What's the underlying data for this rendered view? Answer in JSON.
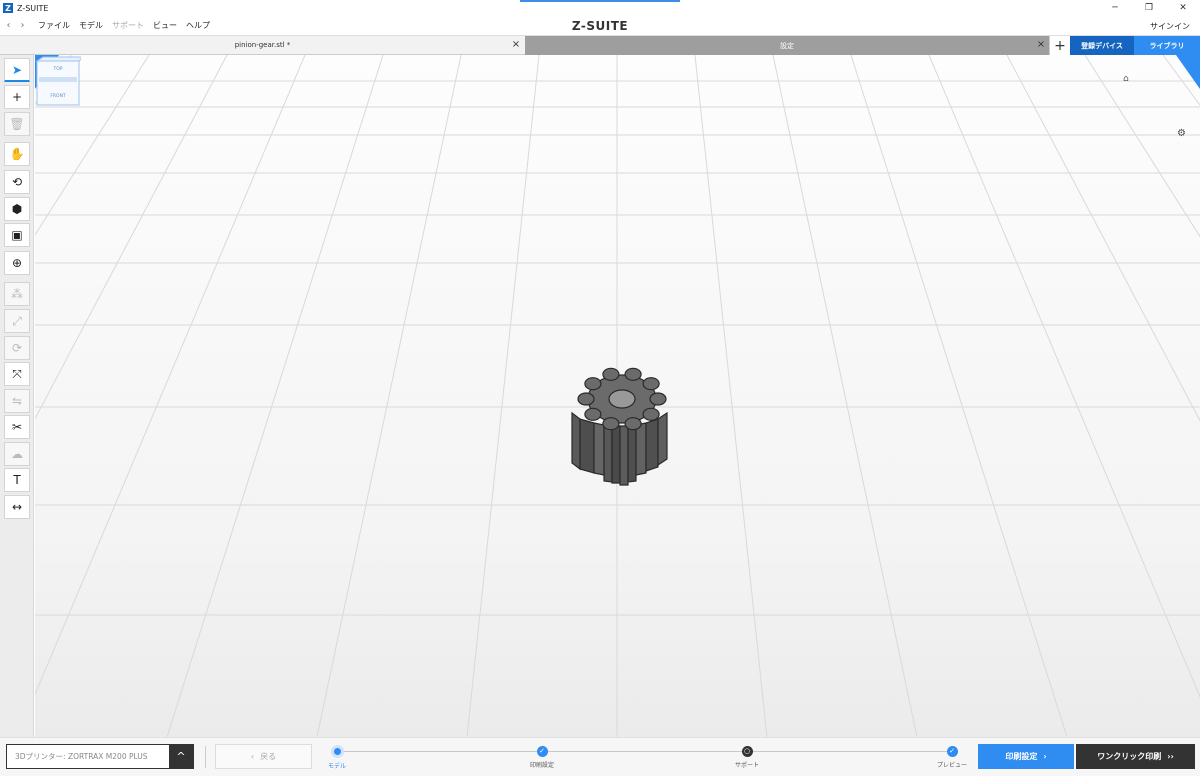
{
  "window": {
    "logo": "Z",
    "title": "Z-SUITE",
    "minimize": "─",
    "restore": "❐",
    "close": "✕"
  },
  "menu": {
    "back": "‹",
    "forward": "›",
    "items": [
      {
        "label": "ファイル",
        "enabled": true
      },
      {
        "label": "モデル",
        "enabled": true
      },
      {
        "label": "サポート",
        "enabled": false
      },
      {
        "label": "ビュー",
        "enabled": true
      },
      {
        "label": "ヘルプ",
        "enabled": true
      }
    ],
    "brand": "Z-SUITE",
    "signin": "サインイン"
  },
  "tabs": {
    "file_tab": "pinion-gear.stl *",
    "settings_tab": "設定",
    "close_glyph": "×",
    "add_glyph": "+",
    "devices": "登録デバイス",
    "library": "ライブラリ"
  },
  "toolbar": {
    "tools": [
      {
        "name": "select-tool",
        "icon": "cursor-icon",
        "glyph": "➤",
        "state": "active"
      },
      {
        "name": "add-model-tool",
        "icon": "plus-icon",
        "glyph": "+",
        "state": "enabled"
      },
      {
        "name": "delete-tool",
        "icon": "trash-icon",
        "glyph": "🗑",
        "state": "disabled"
      },
      {
        "name": "pan-tool",
        "icon": "hand-icon",
        "glyph": "✋",
        "state": "enabled"
      },
      {
        "name": "rotate-view-tool",
        "icon": "rotate-icon",
        "glyph": "⟲",
        "state": "enabled"
      },
      {
        "name": "view-cube-tool",
        "icon": "cube-icon",
        "glyph": "⬢",
        "state": "enabled"
      },
      {
        "name": "camera-tool",
        "icon": "camera-icon",
        "glyph": "▣",
        "state": "enabled"
      },
      {
        "name": "zoom-tool",
        "icon": "zoom-icon",
        "glyph": "⊕",
        "state": "enabled"
      },
      {
        "name": "move-tool",
        "icon": "move-icon",
        "glyph": "⁂",
        "state": "disabled"
      },
      {
        "name": "scale-tool",
        "icon": "scale-icon",
        "glyph": "⤢",
        "state": "disabled"
      },
      {
        "name": "rotate-model-tool",
        "icon": "rotate-model-icon",
        "glyph": "⟳",
        "state": "disabled"
      },
      {
        "name": "auto-arrange-tool",
        "icon": "arrange-icon",
        "glyph": "⤧",
        "state": "enabled"
      },
      {
        "name": "mirror-tool",
        "icon": "mirror-icon",
        "glyph": "⇋",
        "state": "disabled"
      },
      {
        "name": "cut-tool",
        "icon": "scissors-icon",
        "glyph": "✂",
        "state": "enabled"
      },
      {
        "name": "repair-tool",
        "icon": "repair-icon",
        "glyph": "☁",
        "state": "disabled"
      },
      {
        "name": "text-tool",
        "icon": "text-icon",
        "glyph": "T",
        "state": "enabled"
      },
      {
        "name": "measure-tool",
        "icon": "measure-icon",
        "glyph": "↔",
        "state": "enabled"
      }
    ]
  },
  "view_cube": {
    "home": "⌂",
    "top": "TOP",
    "front": "FRONT",
    "settings": "⚙"
  },
  "bottom": {
    "printer_label": "3Dプリンター: ZORTRAX M200 PLUS",
    "printer_toggle": "^",
    "back_icon": "‹",
    "back_label": "戻る",
    "steps": [
      {
        "label": "モデル",
        "state": "current",
        "mark": ""
      },
      {
        "label": "印刷設定",
        "state": "done",
        "mark": "✓"
      },
      {
        "label": "サポート",
        "state": "pending",
        "mark": "○"
      },
      {
        "label": "プレビュー",
        "state": "done",
        "mark": "✓"
      }
    ],
    "print_settings": "印刷設定",
    "print_settings_icon": "›",
    "oneclick": "ワンクリック印刷",
    "oneclick_icon": "››"
  },
  "colors": {
    "accent": "#2f8cf0",
    "accent_dark": "#1565c0",
    "model": "#555555",
    "grid": "#d9d9d9"
  }
}
